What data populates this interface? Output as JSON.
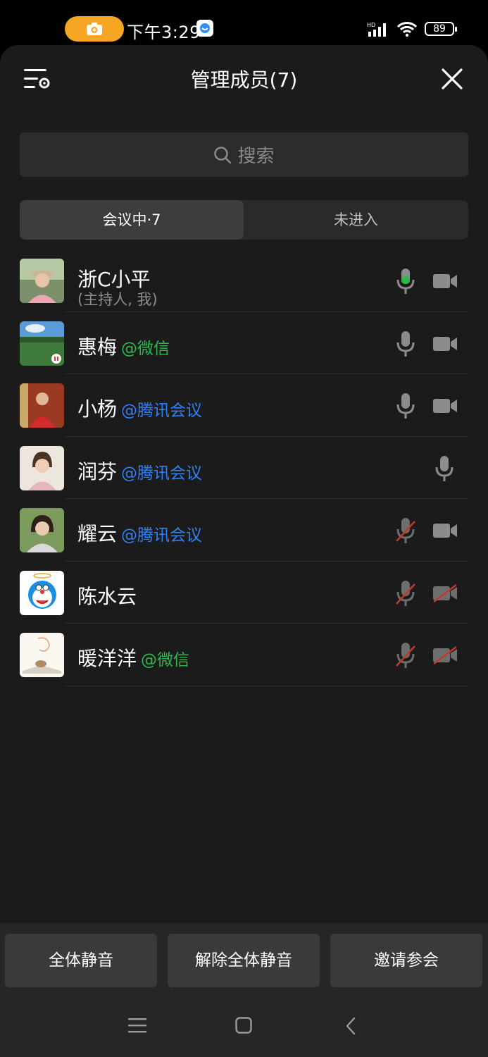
{
  "status_bar": {
    "time": "下午3:29",
    "battery": "89"
  },
  "header": {
    "title": "管理成员(7)"
  },
  "search": {
    "placeholder": "搜索"
  },
  "tabs": {
    "in_meeting": "会议中·7",
    "not_joined": "未进入"
  },
  "members": [
    {
      "name": "浙C小平",
      "tag": "",
      "subtitle": "(主持人, 我)"
    },
    {
      "name": "惠梅",
      "tag": "@微信",
      "subtitle": ""
    },
    {
      "name": "小杨",
      "tag": "@腾讯会议",
      "subtitle": ""
    },
    {
      "name": "润芬",
      "tag": "@腾讯会议",
      "subtitle": ""
    },
    {
      "name": "耀云",
      "tag": "@腾讯会议",
      "subtitle": ""
    },
    {
      "name": "陈水云",
      "tag": "",
      "subtitle": ""
    },
    {
      "name": "暖洋洋",
      "tag": "@微信",
      "subtitle": ""
    }
  ],
  "actions": {
    "mute_all": "全体静音",
    "unmute_all": "解除全体静音",
    "invite": "邀请参会"
  },
  "colors": {
    "wechat_tag": "#2db84d",
    "tencent_tag": "#2f7ff7",
    "mic_active": "#2db84d",
    "muted_slash": "#c0392b",
    "record_pill": "#f5a623"
  }
}
